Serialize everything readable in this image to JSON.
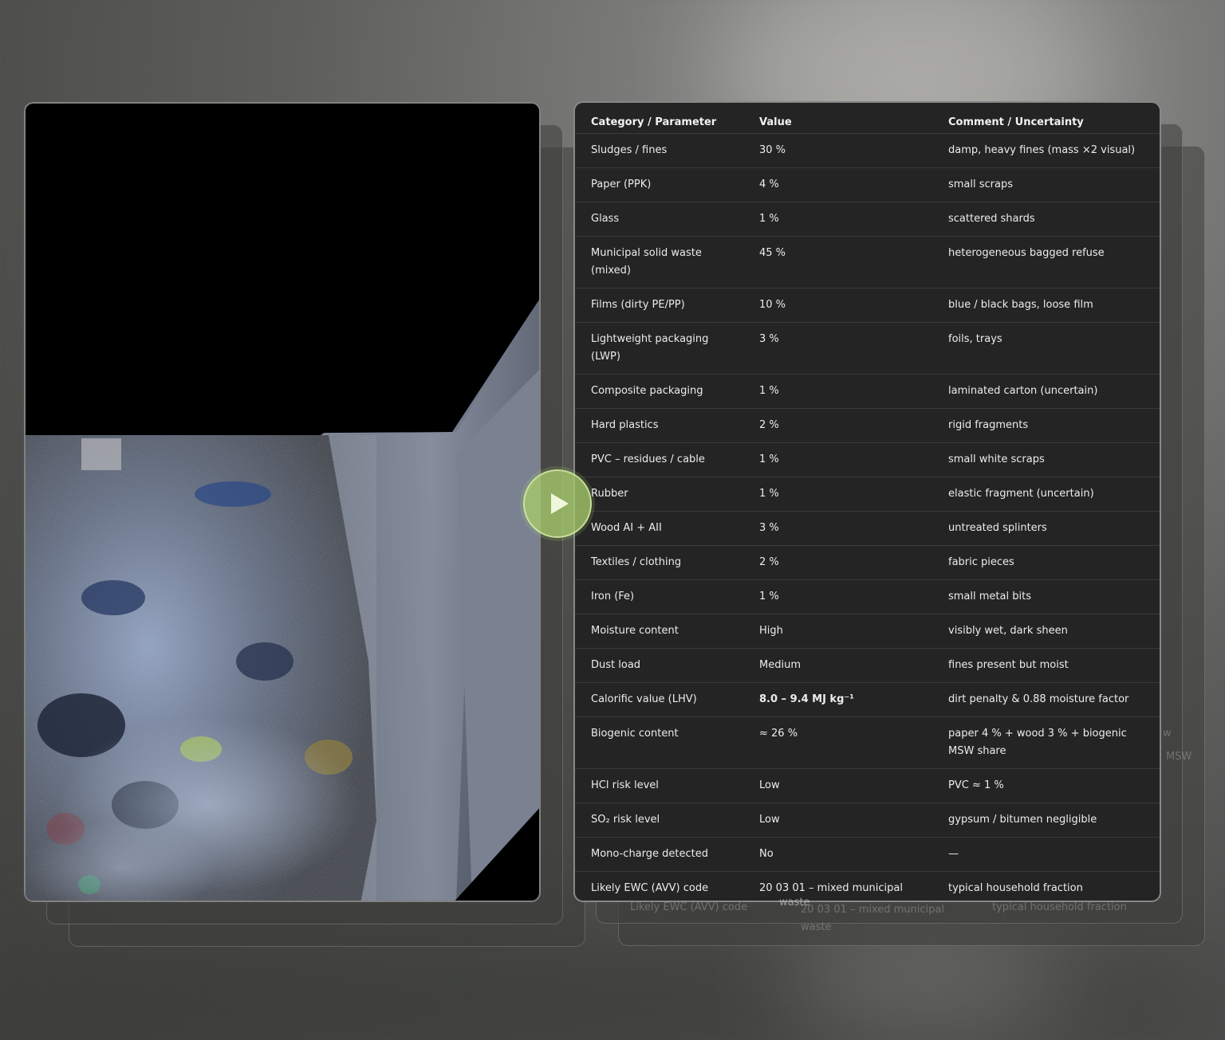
{
  "table": {
    "headers": [
      "Category / Parameter",
      "Value",
      "Comment / Uncertainty"
    ],
    "rows": [
      {
        "category": "Sludges / fines",
        "value": "30 %",
        "comment": "damp, heavy fines (mass ×2 visual)"
      },
      {
        "category": "Paper (PPK)",
        "value": "4 %",
        "comment": "small scraps"
      },
      {
        "category": "Glass",
        "value": "1 %",
        "comment": "scattered shards"
      },
      {
        "category": "Municipal solid waste (mixed)",
        "value": "45 %",
        "comment": "heterogeneous bagged refuse"
      },
      {
        "category": "Films (dirty PE/PP)",
        "value": "10 %",
        "comment": "blue / black bags, loose film"
      },
      {
        "category": "Lightweight packaging (LWP)",
        "value": "3 %",
        "comment": "foils, trays"
      },
      {
        "category": "Composite packaging",
        "value": "1 %",
        "comment": "laminated carton (uncertain)"
      },
      {
        "category": "Hard plastics",
        "value": "2 %",
        "comment": "rigid fragments"
      },
      {
        "category": "PVC – residues / cable",
        "value": "1 %",
        "comment": "small white scraps"
      },
      {
        "category": "Rubber",
        "value": "1 %",
        "comment": "elastic fragment (uncertain)"
      },
      {
        "category": "Wood AI + AII",
        "value": "3 %",
        "comment": "untreated splinters"
      },
      {
        "category": "Textiles / clothing",
        "value": "2 %",
        "comment": "fabric pieces"
      },
      {
        "category": "Iron (Fe)",
        "value": "1 %",
        "comment": "small metal bits"
      },
      {
        "category": "Moisture content",
        "value": "High",
        "comment": "visibly wet, dark sheen"
      },
      {
        "category": "Dust load",
        "value": "Medium",
        "comment": "fines present but moist"
      },
      {
        "category": "Calorific value (LHV)",
        "value": "8.0 – 9.4 MJ kg⁻¹",
        "comment": "dirt penalty & 0.88 moisture factor"
      },
      {
        "category": "Biogenic content",
        "value": "≈ 26 %",
        "comment": "paper 4 % + wood 3 % + biogenic MSW share"
      },
      {
        "category": "HCl risk level",
        "value": "Low",
        "comment": "PVC ≈ 1 %"
      },
      {
        "category": "SO₂ risk level",
        "value": "Low",
        "comment": "gypsum / bitumen negligible"
      },
      {
        "category": "Mono-charge detected",
        "value": "No",
        "comment": "—"
      },
      {
        "category": "Likely EWC (AVV) code",
        "value": "20 03 01 – mixed municipal waste",
        "comment": "typical household fraction"
      }
    ]
  },
  "ghost": {
    "category": "Likely EWC (AVV) code",
    "value": "20 03 01 – mixed municipal waste",
    "comment": "typical household fraction",
    "fragment_a": "w",
    "fragment_b": "MSW",
    "fragment_c": "waste"
  },
  "colors": {
    "accent_play": "#a8cc6c",
    "table_bg": "#242424"
  }
}
